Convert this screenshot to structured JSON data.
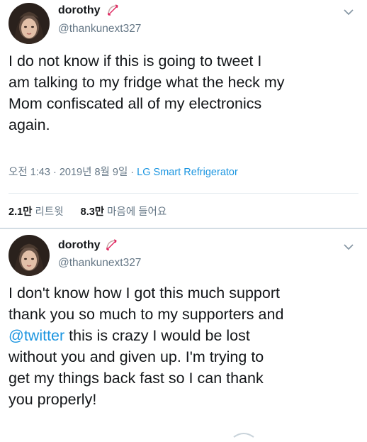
{
  "tweets": [
    {
      "name": "dorothy",
      "handle": "@thankunext327",
      "text": "I do not know if this is going to tweet I\nam talking to my fridge what the heck my\nMom confiscated all of my electronics\nagain.",
      "timestamp": "오전 1:43 · 2019년 8월 9일 · ",
      "source": "LG Smart Refrigerator",
      "retweets_count": "2.1만",
      "retweets_label": "리트윗",
      "likes_count": "8.3만",
      "likes_label": "마음에 들어요"
    },
    {
      "name": "dorothy",
      "handle": "@thankunext327",
      "text_before": "I don't know how I got this much support\nthank you so much to my supporters and\n",
      "mention": "@twitter",
      "text_after": " this is crazy I would be lost\nwithout you and given up. I'm trying to\nget my things back fast so I can thank\nyou properly!"
    }
  ],
  "colors": {
    "link": "#1b95e0",
    "secondary": "#657786",
    "text": "#14171a",
    "bow": "#e0245e"
  },
  "icons": {
    "verified_like_badge": "bow-and-arrow-icon",
    "menu": "chevron-down-icon"
  }
}
